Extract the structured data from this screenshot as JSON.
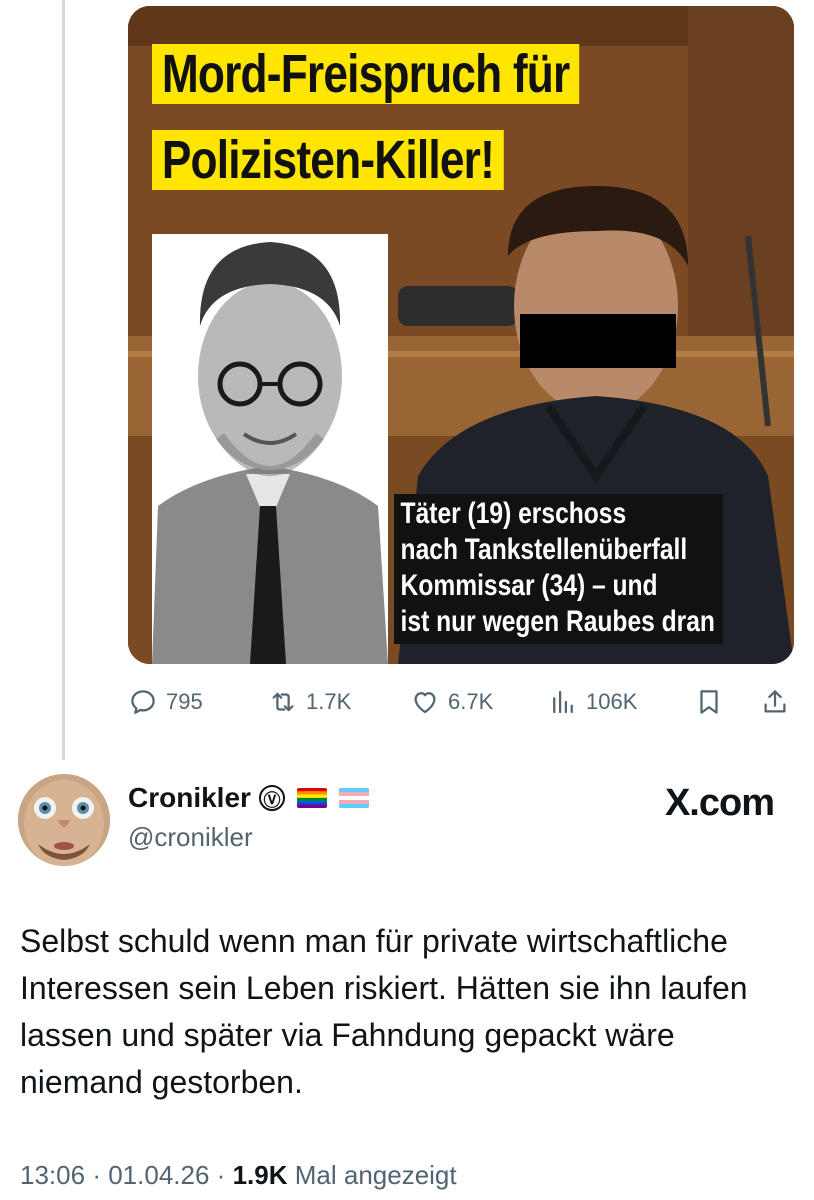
{
  "post_media": {
    "headline_line1": "Mord-Freispruch für",
    "headline_line2": "Polizisten-Killer!",
    "caption_lines": [
      "Täter (19) erschoss",
      "nach Tankstellenüberfall",
      "Kommissar (34) – und",
      "ist nur wegen Raubes dran"
    ]
  },
  "post_actions": {
    "replies": "795",
    "reposts": "1.7K",
    "likes": "6.7K",
    "views": "106K"
  },
  "reply": {
    "display_name": "Cronikler",
    "verified_glyph": "Ⓥ",
    "handle": "@cronikler",
    "brand": "X.com",
    "text": "Selbst schuld wenn man für private wirtschaftliche Interessen sein Leben riskiert. Hätten sie ihn laufen lassen und später via Fahndung gepackt wäre niemand gestorben.",
    "time": "13:06",
    "date": "01.04.26",
    "views_count": "1.9K",
    "views_label": "Mal angezeigt"
  },
  "colors": {
    "headline_bg": "#ffe600",
    "muted_text": "#536471",
    "thread_line": "#cfd9de"
  }
}
